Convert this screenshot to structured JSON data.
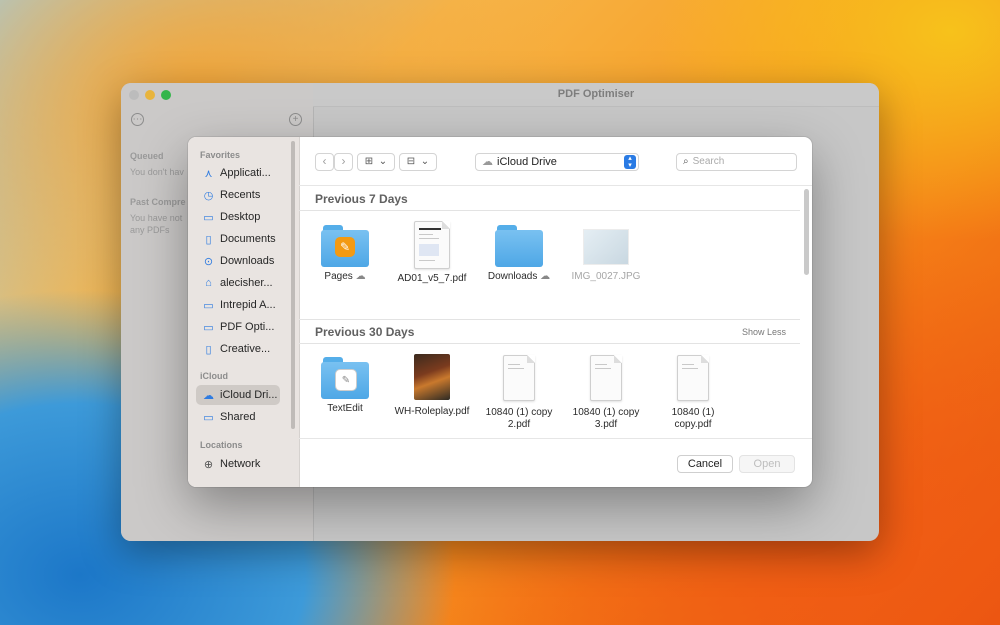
{
  "window": {
    "title": "PDF Optimiser",
    "sidebar_texts": {
      "queued": "Queued",
      "queued_empty": "You don't hav",
      "past": "Past Compre",
      "past_empty_1": "You have not",
      "past_empty_2": "any PDFs"
    }
  },
  "dialog": {
    "sidebar": {
      "favorites_header": "Favorites",
      "icloud_header": "iCloud",
      "locations_header": "Locations",
      "favorites": [
        {
          "label": "Applicati...",
          "icon": "applications-icon"
        },
        {
          "label": "Recents",
          "icon": "clock-icon"
        },
        {
          "label": "Desktop",
          "icon": "desktop-icon"
        },
        {
          "label": "Documents",
          "icon": "document-icon"
        },
        {
          "label": "Downloads",
          "icon": "download-icon"
        },
        {
          "label": "alecisher...",
          "icon": "home-icon"
        },
        {
          "label": "Intrepid A...",
          "icon": "folder-icon"
        },
        {
          "label": "PDF Opti...",
          "icon": "folder-icon"
        },
        {
          "label": "Creative...",
          "icon": "document-icon"
        }
      ],
      "icloud": [
        {
          "label": "iCloud Dri...",
          "icon": "cloud-icon",
          "selected": true
        },
        {
          "label": "Shared",
          "icon": "shared-folder-icon"
        }
      ],
      "locations": [
        {
          "label": "Network",
          "icon": "globe-icon"
        }
      ]
    },
    "toolbar": {
      "location": "iCloud Drive",
      "search_placeholder": "Search"
    },
    "groups": [
      {
        "title": "Previous 7 Days",
        "items": [
          {
            "label": "Pages",
            "kind": "folder-pages",
            "cloud": true
          },
          {
            "label": "AD01_v5_7.pdf",
            "kind": "pdf"
          },
          {
            "label": "Downloads",
            "kind": "folder",
            "cloud": true
          },
          {
            "label": "IMG_0027.JPG",
            "kind": "image",
            "dim": true
          }
        ]
      },
      {
        "title": "Previous 30 Days",
        "action": "Show Less",
        "items": [
          {
            "label": "TextEdit",
            "kind": "folder-textedit"
          },
          {
            "label": "WH-Roleplay.pdf",
            "kind": "book"
          },
          {
            "label": "10840 (1) copy 2.pdf",
            "line1": "10840 (1) copy",
            "line2": "2.pdf",
            "kind": "doc"
          },
          {
            "label": "10840 (1) copy 3.pdf",
            "line1": "10840 (1) copy",
            "line2": "3.pdf",
            "kind": "doc"
          },
          {
            "label": "10840 (1) copy.pdf",
            "line1": "10840 (1)",
            "line2": "copy.pdf",
            "kind": "doc"
          }
        ]
      }
    ],
    "buttons": {
      "cancel": "Cancel",
      "open": "Open"
    },
    "colors": {
      "accent": "#2a7be4",
      "folder": "#5aaeea",
      "sidebar_bg": "#e9e4e1"
    }
  }
}
